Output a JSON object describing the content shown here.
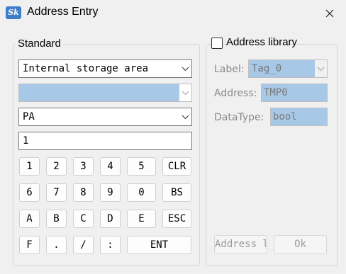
{
  "window": {
    "title": "Address Entry",
    "app_icon_text": "Sk",
    "icons": {
      "app": "app-icon",
      "close": "close-icon"
    }
  },
  "standard": {
    "legend": "Standard",
    "area_select": "Internal storage area",
    "device_select": "",
    "register_select": "PA",
    "value_input": "1",
    "keypad": [
      [
        "1",
        "2",
        "3",
        "4",
        "5",
        "CLR"
      ],
      [
        "6",
        "7",
        "8",
        "9",
        "0",
        "BS"
      ],
      [
        "A",
        "B",
        "C",
        "D",
        "E",
        "ESC"
      ],
      [
        "F",
        ".",
        "/",
        ":",
        "ENT"
      ]
    ]
  },
  "library": {
    "checkbox_label": "Address library",
    "checked": false,
    "label_caption": "Label:",
    "label_value": "Tag_0",
    "address_caption": "Address:",
    "address_value": "TMP0",
    "datatype_caption": "DataType:",
    "datatype_value": "bool",
    "address_lib_button": "Address lib",
    "ok_button": "Ok"
  },
  "colors": {
    "disabled_field": "#a8c8e8",
    "window_bg": "#f0f0f0"
  }
}
